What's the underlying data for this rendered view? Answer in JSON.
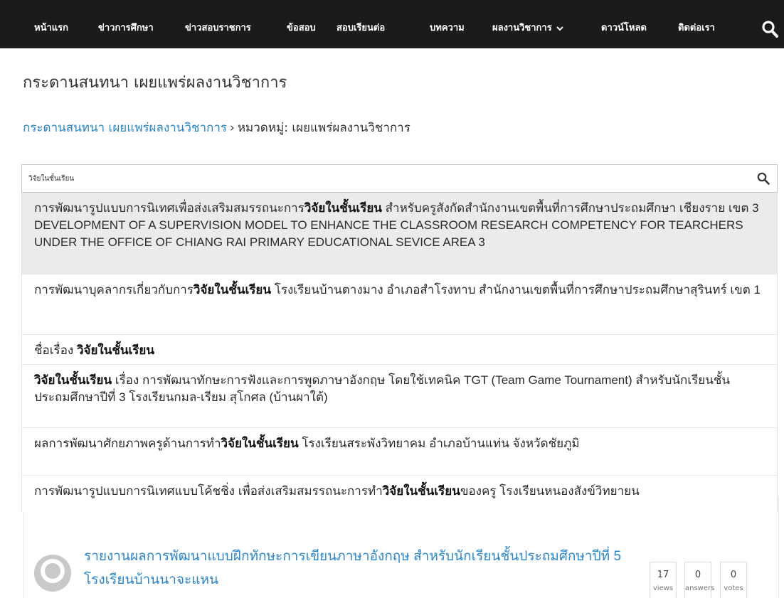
{
  "nav": {
    "items": [
      {
        "label": "หน้าแรก"
      },
      {
        "label": "ข่าวการศึกษา"
      },
      {
        "label": "ข่าวสอบราชการ"
      },
      {
        "label": "ข้อสอบ"
      },
      {
        "label": "สอบเรียนต่อ"
      },
      {
        "label": "บทความ"
      },
      {
        "label": "ผลงานวิชาการ",
        "has_dropdown": true
      },
      {
        "label": "ดาวน์โหลด"
      },
      {
        "label": "ติดต่อเรา"
      }
    ],
    "search_icon": "search-icon"
  },
  "page_title": "กระดานสนทนา เผยแพร่ผลงานวิชาการ",
  "breadcrumb": {
    "link": "กระดานสนทนา เผยแพร่ผลงานวิชาการ",
    "separator": "›",
    "current": "หมวดหมู่: เผยแพร่ผลงานวิชาการ"
  },
  "search": {
    "value": "วิจัยในชั้นเรียน",
    "suggestions": [
      {
        "before": "การพัฒนารูปแบบการนิเทศเพื่อส่งเสริมสมรรถนะการ",
        "match": "วิจัยในชั้นเรียน",
        "after": " สำหรับครูสังกัดสำนักงานเขตพื้นที่การศึกษาประถมศึกษา เชียงราย เขต 3 DEVELOPMENT OF A SUPERVISION MODEL TO ENHANCE THE CLASSROOM RESEARCH COMPETENCY FOR TEARCHERS UNDER THE OFFICE OF CHIANG RAI PRIMARY EDUCATIONAL SEVICE AREA 3"
      },
      {
        "before": "การพัฒนาบุคลากรเกี่ยวกับการ",
        "match": "วิจัยในชั้นเรียน",
        "after": " โรงเรียนบ้านตางมาง อำเภอสำโรงทาบ สำนักงานเขตพื้นที่การศึกษาประถมศึกษาสุรินทร์ เขต 1"
      },
      {
        "before": "ชื่อเรื่อง ",
        "match": "วิจัยในชั้นเรียน",
        "after": ""
      },
      {
        "before": "",
        "match": "วิจัยในชั้นเรียน",
        "after": " เรื่อง การพัฒนาทักษะการฟังและการพูดภาษาอังกฤษ โดยใช้เทคนิค TGT (Team Game Tournament) สำหรับนักเรียนชั้นประถมศึกษาปีที่ 3 โรงเรียนกมล-เรียม สุโกศล (บ้านผาใต้)"
      },
      {
        "before": "ผลการพัฒนาศักยภาพครูด้านการทำ",
        "match": "วิจัยในชั้นเรียน",
        "after": " โรงเรียนสระพังวิทยาคม อำเภอบ้านแท่น จังหวัดชัยภูมิ"
      },
      {
        "before": "การพัฒนารูปแบบการนิเทศแบบโค้ชชิ่ง เพื่อส่งเสริมสมรรถนะการทำ",
        "match": "วิจัยในชั้นเรียน",
        "after": "ของครู โรงเรียนหนองสังข์วิทยายน"
      }
    ]
  },
  "question": {
    "title": "รายงานผลการพัฒนาแบบฝึกทักษะการเขียนภาษาอังกฤษ สำหรับนักเรียนชั้นประถมศึกษาปีที่ 5 โรงเรียนบ้านนาจะแหน",
    "stats": [
      {
        "value": "17",
        "label": "views"
      },
      {
        "value": "0",
        "label": "answers"
      },
      {
        "value": "0",
        "label": "votes"
      }
    ]
  }
}
